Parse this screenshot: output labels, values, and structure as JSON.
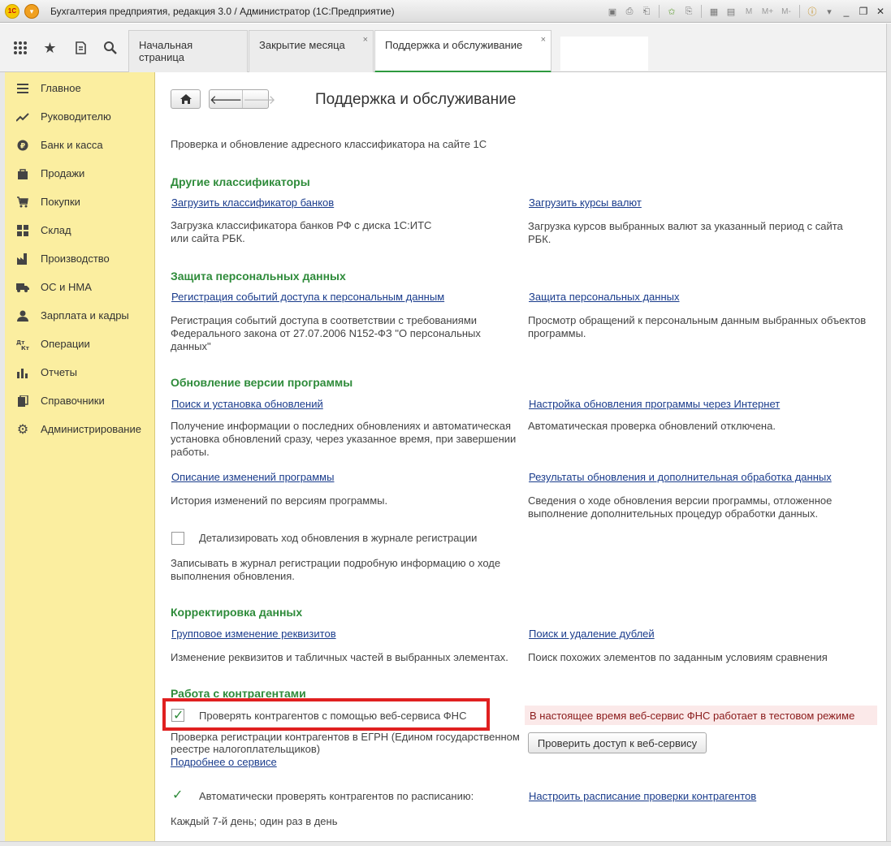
{
  "window": {
    "title": "Бухгалтерия предприятия, редакция 3.0 / Администратор  (1С:Предприятие)",
    "logo_text": "1С",
    "m_buttons": [
      "M",
      "M+",
      "M-"
    ]
  },
  "tabs": [
    {
      "label": "Начальная страница",
      "closable": false
    },
    {
      "label": "Закрытие месяца",
      "closable": true
    },
    {
      "label": "Поддержка и обслуживание",
      "closable": true,
      "active": true
    }
  ],
  "sidebar": {
    "items": [
      {
        "label": "Главное",
        "icon": "menu-icon"
      },
      {
        "label": "Руководителю",
        "icon": "trend-icon"
      },
      {
        "label": "Банк и касса",
        "icon": "coin-icon"
      },
      {
        "label": "Продажи",
        "icon": "bag-icon"
      },
      {
        "label": "Покупки",
        "icon": "cart-icon"
      },
      {
        "label": "Склад",
        "icon": "grid-icon"
      },
      {
        "label": "Производство",
        "icon": "factory-icon"
      },
      {
        "label": "ОС и НМА",
        "icon": "truck-icon"
      },
      {
        "label": "Зарплата и кадры",
        "icon": "person-icon"
      },
      {
        "label": "Операции",
        "icon": "dt-kt-icon"
      },
      {
        "label": "Отчеты",
        "icon": "bar-chart-icon"
      },
      {
        "label": "Справочники",
        "icon": "books-icon"
      },
      {
        "label": "Администрирование",
        "icon": "gear-icon"
      }
    ]
  },
  "main": {
    "title": "Поддержка и обслуживание",
    "intro": "Проверка и обновление адресного классификатора на сайте 1С",
    "sections": {
      "other_classifiers": {
        "heading": "Другие классификаторы",
        "left_link": "Загрузить классификатор банков",
        "left_desc_1": "Загрузка классификатора банков РФ с диска 1С:ИТС",
        "left_desc_2": "или сайта РБК.",
        "right_link": "Загрузить курсы валют",
        "right_desc_1": "Загрузка курсов выбранных валют за указанный период с сайта",
        "right_desc_2": "РБК."
      },
      "personal_data": {
        "heading": "Защита персональных данных",
        "left_link": "Регистрация событий доступа к персональным данным",
        "left_desc_1": "Регистрация событий доступа в соответствии с требованиями",
        "left_desc_2": "Федерального закона от 27.07.2006 N152-ФЗ \"О персональных",
        "left_desc_3": "данных\"",
        "right_link": "Защита персональных данных",
        "right_desc_1": "Просмотр обращений к персональным данным выбранных объектов",
        "right_desc_2": "программы."
      },
      "update": {
        "heading": "Обновление версии программы",
        "left_link": "Поиск и установка обновлений",
        "left_desc_1": "Получение информации о последних обновлениях и автоматическая",
        "left_desc_2": "установка обновлений сразу, через указанное время, при завершении",
        "left_desc_3": "работы.",
        "right_link": "Настройка обновления программы через Интернет",
        "right_desc_1": "Автоматическая проверка обновлений отключена.",
        "left_link_2": "Описание изменений программы",
        "left_desc2_1": "История изменений по версиям программы.",
        "right_link_2": "Результаты обновления и дополнительная обработка данных",
        "right_desc2_1": "Сведения о ходе обновления версии программы, отложенное",
        "right_desc2_2": "выполнение дополнительных процедур обработки данных.",
        "checkbox_label": "Детализировать ход обновления в журнале регистрации",
        "checkbox_checked": false,
        "checkbox_desc_1": "Записывать в журнал регистрации подробную информацию о ходе",
        "checkbox_desc_2": "выполнения обновления."
      },
      "data_correction": {
        "heading": "Корректировка данных",
        "left_link": "Групповое изменение реквизитов",
        "left_desc_1": "Изменение реквизитов и табличных частей в выбранных элементах.",
        "right_link": "Поиск и удаление дублей",
        "right_desc_1": "Поиск похожих элементов по заданным условиям сравнения"
      },
      "counterparties": {
        "heading": "Работа с контрагентами",
        "fns_checkbox_label": "Проверять контрагентов с помощью веб-сервиса ФНС",
        "fns_checkbox_checked": true,
        "fns_desc_1": "Проверка регистрации контрагентов в ЕГРН (Едином государственном",
        "fns_desc_2": "реестре налогоплательщиков)",
        "fns_more_link": "Подробнее о сервисе",
        "warning": "В настоящее время веб-сервис ФНС работает в тестовом режиме",
        "check_button": "Проверить доступ к веб-сервису",
        "auto_checkbox_label": "Автоматически проверять контрагентов по расписанию:",
        "auto_checkbox_checked": true,
        "schedule_link": "Настроить расписание проверки контрагентов",
        "schedule_desc": "Каждый 7-й день; один раз в день"
      }
    }
  }
}
